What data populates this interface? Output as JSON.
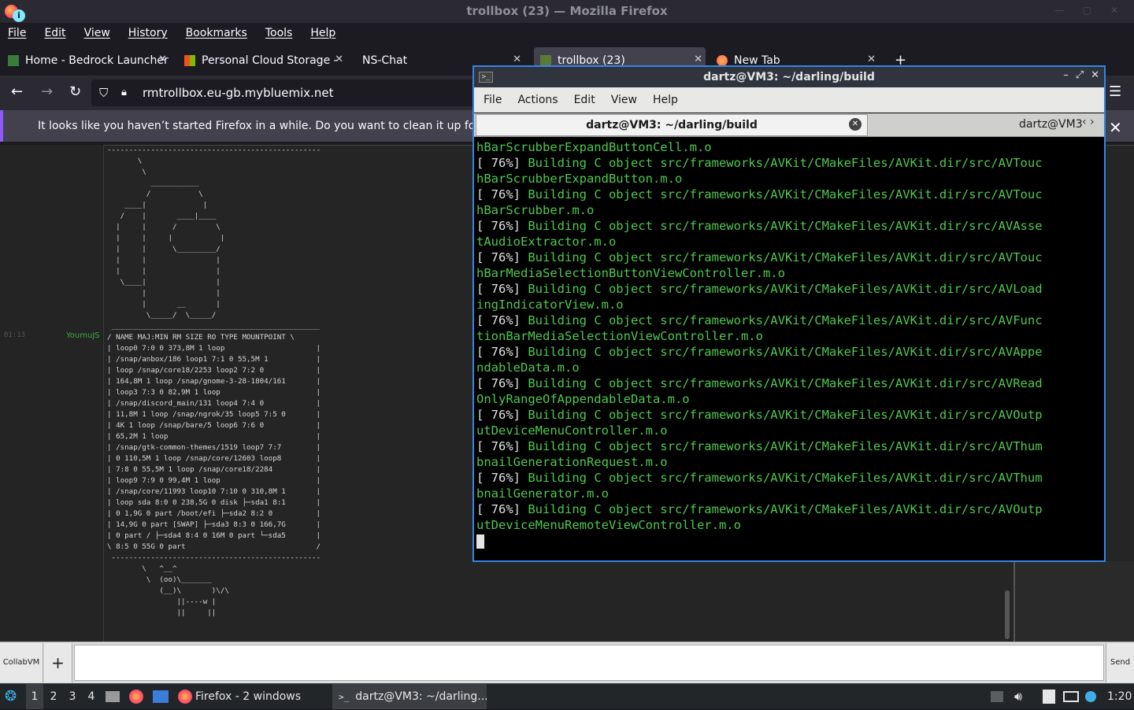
{
  "firefox": {
    "title": "trollbox (23) — Mozilla Firefox",
    "menu": [
      "File",
      "Edit",
      "View",
      "History",
      "Bookmarks",
      "Tools",
      "Help"
    ],
    "tabs": [
      {
        "label": "Home - Bedrock Launcher"
      },
      {
        "label": "Personal Cloud Storage - "
      },
      {
        "label": "NS-Chat"
      },
      {
        "label": "trollbox (23)"
      },
      {
        "label": "New Tab"
      }
    ],
    "url": "rmtrollbox.eu-gb.mybluemix.net",
    "notice": "It looks like you haven’t started Firefox in a while. Do you want to clean it up for a fresh, like-new experience?"
  },
  "chat": {
    "time": "01:13",
    "user": "YoumuJS",
    "ascii_top": "--------------------------------------------------\n       \\\n        \\\n          ___________\n         /           \\\n    ____|             |\n   /    |       ____|____\n  |     |      /         \\\n  |     |     |           |\n  |     |      \\_________/\n  |     |                |\n  |     |                |\n   \\____|                |\n        |                |\n        |       __       |\n         \\_____/  \\_____/",
    "table_lines": [
      " ________________________________________________",
      "/ NAME MAJ:MIN RM SIZE RO TYPE MOUNTPOINT \\",
      "| loop0 7:0 0 373,8M 1 loop                     |",
      "| /snap/anbox/186 loop1 7:1 0 55,5M 1           |",
      "| loop /snap/core18/2253 loop2 7:2 0            |",
      "| 164,8M 1 loop /snap/gnome-3-28-1804/161       |",
      "| loop3 7:3 0 82,9M 1 loop                      |",
      "| /snap/discord_main/131 loop4 7:4 0            |",
      "| 11,8M 1 loop /snap/ngrok/35 loop5 7:5 0       |",
      "| 4K 1 loop /snap/bare/5 loop6 7:6 0            |",
      "| 65,2M 1 loop                                  |",
      "| /snap/gtk-common-themes/1519 loop7 7:7        |",
      "| 0 110,5M 1 loop /snap/core/12603 loop8        |",
      "| 7:8 0 55,5M 1 loop /snap/core18/2284          |",
      "| loop9 7:9 0 99,4M 1 loop                      |",
      "| /snap/core/11993 loop10 7:10 0 310,8M 1       |",
      "| loop sda 8:0 0 238,5G 0 disk ├─sda1 8:1       |",
      "| 0 1,9G 0 part /boot/efi ├─sda2 8:2 0          |",
      "| 14,9G 0 part [SWAP] ├─sda3 8:3 0 166,7G       |",
      "| 0 part / ├─sda4 8:4 0 16M 0 part └─sda5       |",
      "\\ 8:5 0 55G 0 part                              /",
      " ------------------------------------------------"
    ],
    "ascii_cow": "        \\   ^__^\n         \\  (oo)\\_______\n            (__)\\       )\\/\\\n                ||----w |\n                ||     ||",
    "collab_label": "CollabVM",
    "plus_label": "+",
    "send_label": "Send"
  },
  "terminal": {
    "title": "dartz@VM3: ~/darling/build",
    "menu": [
      "File",
      "Actions",
      "Edit",
      "View",
      "Help"
    ],
    "tab1": "dartz@VM3: ~/darling/build",
    "tab2": "dartz@VM3",
    "lines": [
      {
        "p": "",
        "g": "hBarScrubberExpandButtonCell.m.o"
      },
      {
        "p": "[ 76%] ",
        "g": "Building C object src/frameworks/AVKit/CMakeFiles/AVKit.dir/src/AVTouc"
      },
      {
        "p": "",
        "g": "hBarScrubberExpandButton.m.o"
      },
      {
        "p": "[ 76%] ",
        "g": "Building C object src/frameworks/AVKit/CMakeFiles/AVKit.dir/src/AVTouc"
      },
      {
        "p": "",
        "g": "hBarScrubber.m.o"
      },
      {
        "p": "[ 76%] ",
        "g": "Building C object src/frameworks/AVKit/CMakeFiles/AVKit.dir/src/AVAsse"
      },
      {
        "p": "",
        "g": "tAudioExtractor.m.o"
      },
      {
        "p": "[ 76%] ",
        "g": "Building C object src/frameworks/AVKit/CMakeFiles/AVKit.dir/src/AVTouc"
      },
      {
        "p": "",
        "g": "hBarMediaSelectionButtonViewController.m.o"
      },
      {
        "p": "[ 76%] ",
        "g": "Building C object src/frameworks/AVKit/CMakeFiles/AVKit.dir/src/AVLoad"
      },
      {
        "p": "",
        "g": "ingIndicatorView.m.o"
      },
      {
        "p": "[ 76%] ",
        "g": "Building C object src/frameworks/AVKit/CMakeFiles/AVKit.dir/src/AVFunc"
      },
      {
        "p": "",
        "g": "tionBarMediaSelectionViewController.m.o"
      },
      {
        "p": "[ 76%] ",
        "g": "Building C object src/frameworks/AVKit/CMakeFiles/AVKit.dir/src/AVAppe"
      },
      {
        "p": "",
        "g": "ndableData.m.o"
      },
      {
        "p": "[ 76%] ",
        "g": "Building C object src/frameworks/AVKit/CMakeFiles/AVKit.dir/src/AVRead"
      },
      {
        "p": "",
        "g": "OnlyRangeOfAppendableData.m.o"
      },
      {
        "p": "[ 76%] ",
        "g": "Building C object src/frameworks/AVKit/CMakeFiles/AVKit.dir/src/AVOutp"
      },
      {
        "p": "",
        "g": "utDeviceMenuController.m.o"
      },
      {
        "p": "[ 76%] ",
        "g": "Building C object src/frameworks/AVKit/CMakeFiles/AVKit.dir/src/AVThum"
      },
      {
        "p": "",
        "g": "bnailGenerationRequest.m.o"
      },
      {
        "p": "[ 76%] ",
        "g": "Building C object src/frameworks/AVKit/CMakeFiles/AVKit.dir/src/AVThum"
      },
      {
        "p": "",
        "g": "bnailGenerator.m.o"
      },
      {
        "p": "[ 76%] ",
        "g": "Building C object src/frameworks/AVKit/CMakeFiles/AVKit.dir/src/AVOutp"
      },
      {
        "p": "",
        "g": "utDeviceMenuRemoteViewController.m.o"
      }
    ]
  },
  "taskbar": {
    "workspaces": [
      "1",
      "2",
      "3",
      "4"
    ],
    "firefox_windows": "Firefox - 2 windows",
    "terminal": "dartz@VM3: ~/darling...",
    "clock": "1:20"
  },
  "icons": {
    "back": "back-arrow-icon",
    "forward": "forward-arrow-icon",
    "reload": "reload-icon",
    "shield": "shield-icon",
    "lock": "lock-icon",
    "menu": "hamburger-menu-icon",
    "info": "info-icon",
    "volume": "volume-icon"
  },
  "colors": {
    "firefox_bg": "#1c1b22",
    "terminal_green": "#4ec94e",
    "terminal_border": "#3584e4"
  }
}
